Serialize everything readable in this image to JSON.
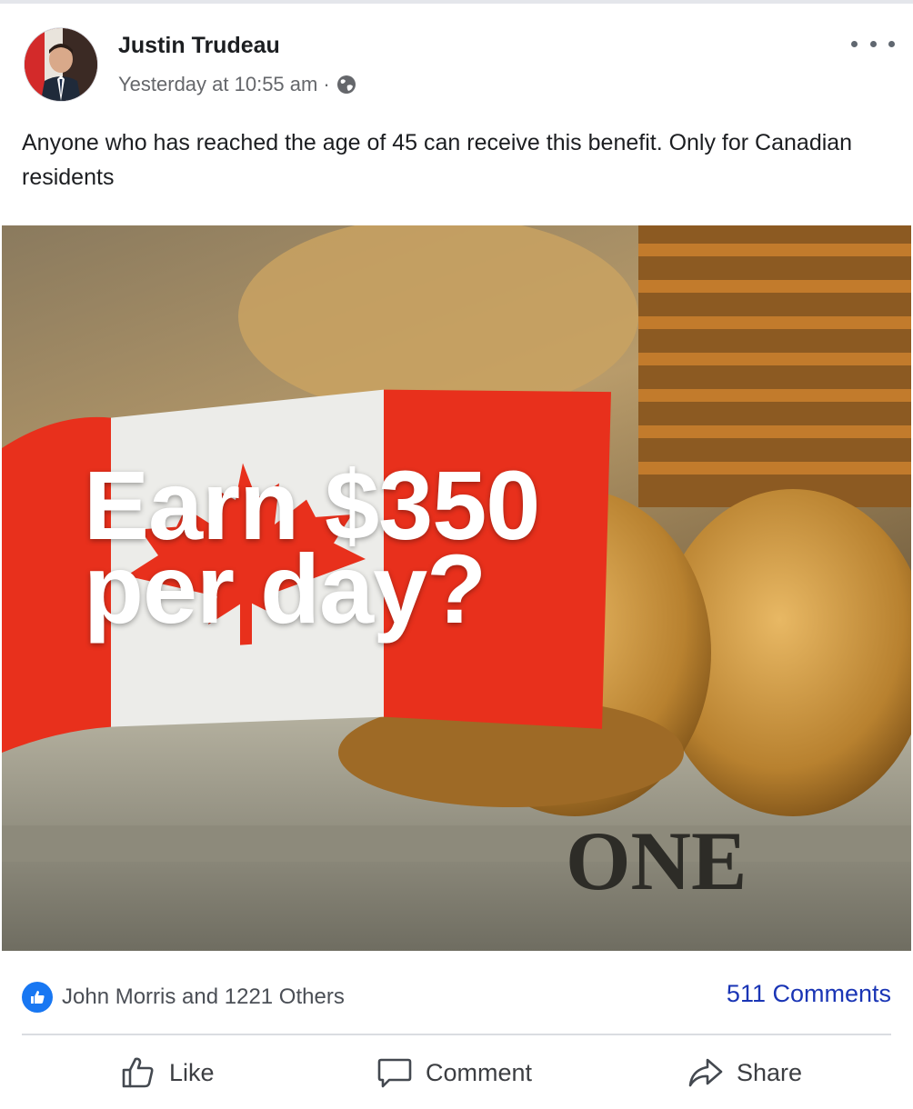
{
  "post": {
    "author": "Justin Trudeau",
    "timestamp": "Yesterday at 10:55 am",
    "separator": "·",
    "privacy_icon": "globe-icon",
    "text": "Anyone who has reached the age of 45 can receive this benefit. Only for Canadian residents",
    "image": {
      "headline": "Earn $350\nper day?",
      "bill_text": "ONE"
    }
  },
  "engagement": {
    "reaction_icon": "thumbs-up-icon",
    "reactions_text": "John Morris and 1221 Others",
    "comments_text": "511 Comments"
  },
  "actions": [
    {
      "label": "Like",
      "icon": "like-icon"
    },
    {
      "label": "Comment",
      "icon": "comment-icon"
    },
    {
      "label": "Share",
      "icon": "share-icon"
    }
  ],
  "colors": {
    "accent": "#1877f2",
    "comments_link": "#1a35b5",
    "flag_red": "#e8301c",
    "meta_text": "#65676b"
  }
}
